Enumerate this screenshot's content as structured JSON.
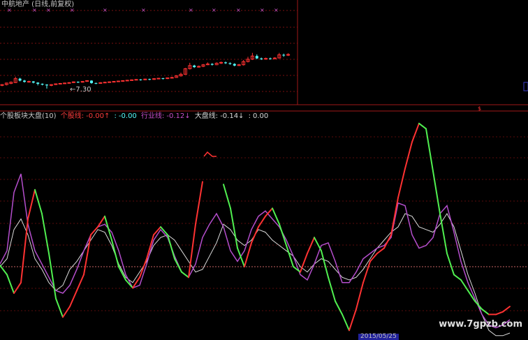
{
  "kchart": {
    "title": "中航地产 (日线,前复权)",
    "low_label": "←7.30",
    "candle_colors": {
      "up": "#ff3232",
      "down": "#54fcfc",
      "flat": "#ffffff"
    },
    "ex_marker": "×",
    "ex_marker_color": "#d25ad2"
  },
  "indicator": {
    "name": "个股板块大盘(10)",
    "items": [
      {
        "label": "个股线:",
        "value": "-0.00↑",
        "color": "#ff3c3c"
      },
      {
        "label": ":",
        "value": "-0.00",
        "color": "#54fcfc"
      },
      {
        "label": "行业线:",
        "value": "-0.12↓",
        "color": "#c84ec8"
      },
      {
        "label": "大盘线:",
        "value": "-0.14↓",
        "color": "#d8d8d8"
      },
      {
        "label": ":",
        "value": "0.00",
        "color": "#d8d8d8"
      }
    ],
    "colors": {
      "stock_up": "#ff3232",
      "stock_down": "#50f050",
      "sector": "#b44ecc",
      "market": "#dcdcdc"
    }
  },
  "watermark": "www.7gpzb.com",
  "date_tag": "2015/05/25"
}
